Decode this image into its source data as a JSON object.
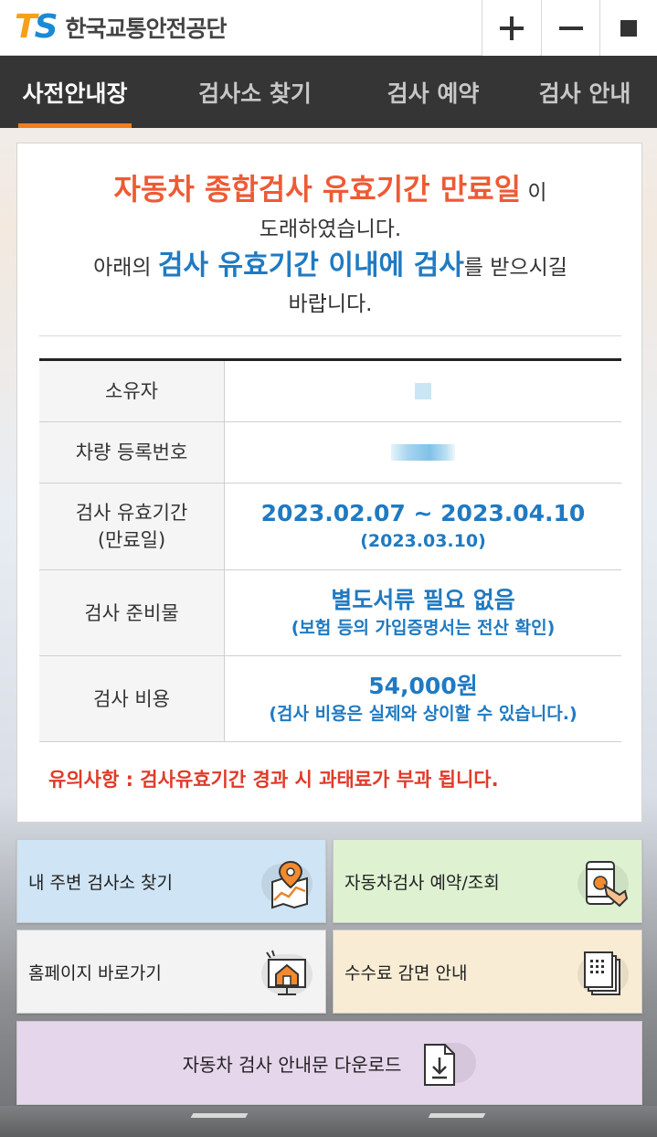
{
  "header": {
    "logo_mark": "TS",
    "logo_text": "한국교통안전공단",
    "zoom_in_icon": "plus-icon",
    "zoom_out_icon": "minus-icon",
    "stop_icon": "square-icon"
  },
  "nav": {
    "tabs": [
      {
        "label": "사전안내장",
        "active": true
      },
      {
        "label": "검사소 찾기",
        "active": false
      },
      {
        "label": "검사 예약",
        "active": false
      },
      {
        "label": "검사 안내",
        "active": false
      }
    ]
  },
  "notice": {
    "line1_highlight": "자동차 종합검사 유효기간 만료일",
    "line1_tail": "이",
    "line2": "도래하였습니다.",
    "line3_head": "아래의",
    "line3_highlight": "검사 유효기간 이내에 검사",
    "line3_tail": "를 받으시길",
    "line4": "바랍니다."
  },
  "table": {
    "owner_label": "소유자",
    "plate_label": "차량 등록번호",
    "period_label_1": "검사 유효기간",
    "period_label_2": "(만료일)",
    "period_value": "2023.02.07 ~ 2023.04.10",
    "period_expiry": "(2023.03.10)",
    "docs_label": "검사 준비물",
    "docs_value": "별도서류 필요 없음",
    "docs_note": "(보험 등의 가입증명서는 전산 확인)",
    "fee_label": "검사 비용",
    "fee_value": "54,000원",
    "fee_note": "(검사 비용은 실제와 상이할 수 있습니다.)"
  },
  "caution": "유의사항 : 검사유효기간 경과 시 과태료가 부과 됩니다.",
  "quick_links": {
    "find_center": "내 주변 검사소 찾기",
    "reserve": "자동차검사 예약/조회",
    "homepage": "홈페이지 바로가기",
    "fee_discount": "수수료 감면 안내",
    "download": "자동차 검사 안내문 다운로드"
  },
  "colors": {
    "accent_orange": "#f07d1e",
    "notice_red": "#ee5a34",
    "value_blue": "#1f7ac2",
    "caution_red": "#e03b2a",
    "nav_bg": "#353535"
  }
}
